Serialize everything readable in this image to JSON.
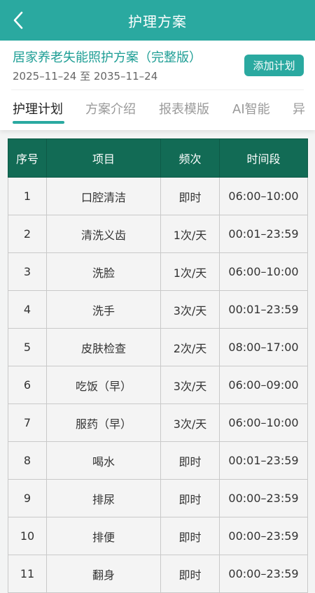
{
  "header": {
    "title": "护理方案",
    "back_icon": "chevron-left-icon"
  },
  "plan": {
    "name": "居家养老失能照护方案（完整版）",
    "dates": "2025–11–24 至 2035–11–24",
    "add_button_label": "添加计划"
  },
  "tabs": [
    {
      "label": "护理计划",
      "active": true
    },
    {
      "label": "方案介绍",
      "active": false
    },
    {
      "label": "报表模版",
      "active": false
    },
    {
      "label": "AI智能",
      "active": false
    },
    {
      "label": "异",
      "active": false
    }
  ],
  "table": {
    "headers": [
      "序号",
      "项目",
      "频次",
      "时间段"
    ],
    "rows": [
      [
        "1",
        "口腔清洁",
        "即时",
        "06:00–10:00"
      ],
      [
        "2",
        "清洗义齿",
        "1次/天",
        "00:01–23:59"
      ],
      [
        "3",
        "洗脸",
        "1次/天",
        "06:00–10:00"
      ],
      [
        "4",
        "洗手",
        "3次/天",
        "00:01–23:59"
      ],
      [
        "5",
        "皮肤检查",
        "2次/天",
        "08:00–17:00"
      ],
      [
        "6",
        "吃饭（早）",
        "3次/天",
        "06:00–09:00"
      ],
      [
        "7",
        "服药（早）",
        "3次/天",
        "06:00–10:00"
      ],
      [
        "8",
        "喝水",
        "即时",
        "00:01–23:59"
      ],
      [
        "9",
        "排尿",
        "即时",
        "00:00–23:59"
      ],
      [
        "10",
        "排便",
        "即时",
        "00:00–23:59"
      ],
      [
        "11",
        "翻身",
        "即时",
        "00:00–23:59"
      ]
    ]
  },
  "colors": {
    "primary": "#2aa9a0",
    "table_header": "#126b55"
  }
}
